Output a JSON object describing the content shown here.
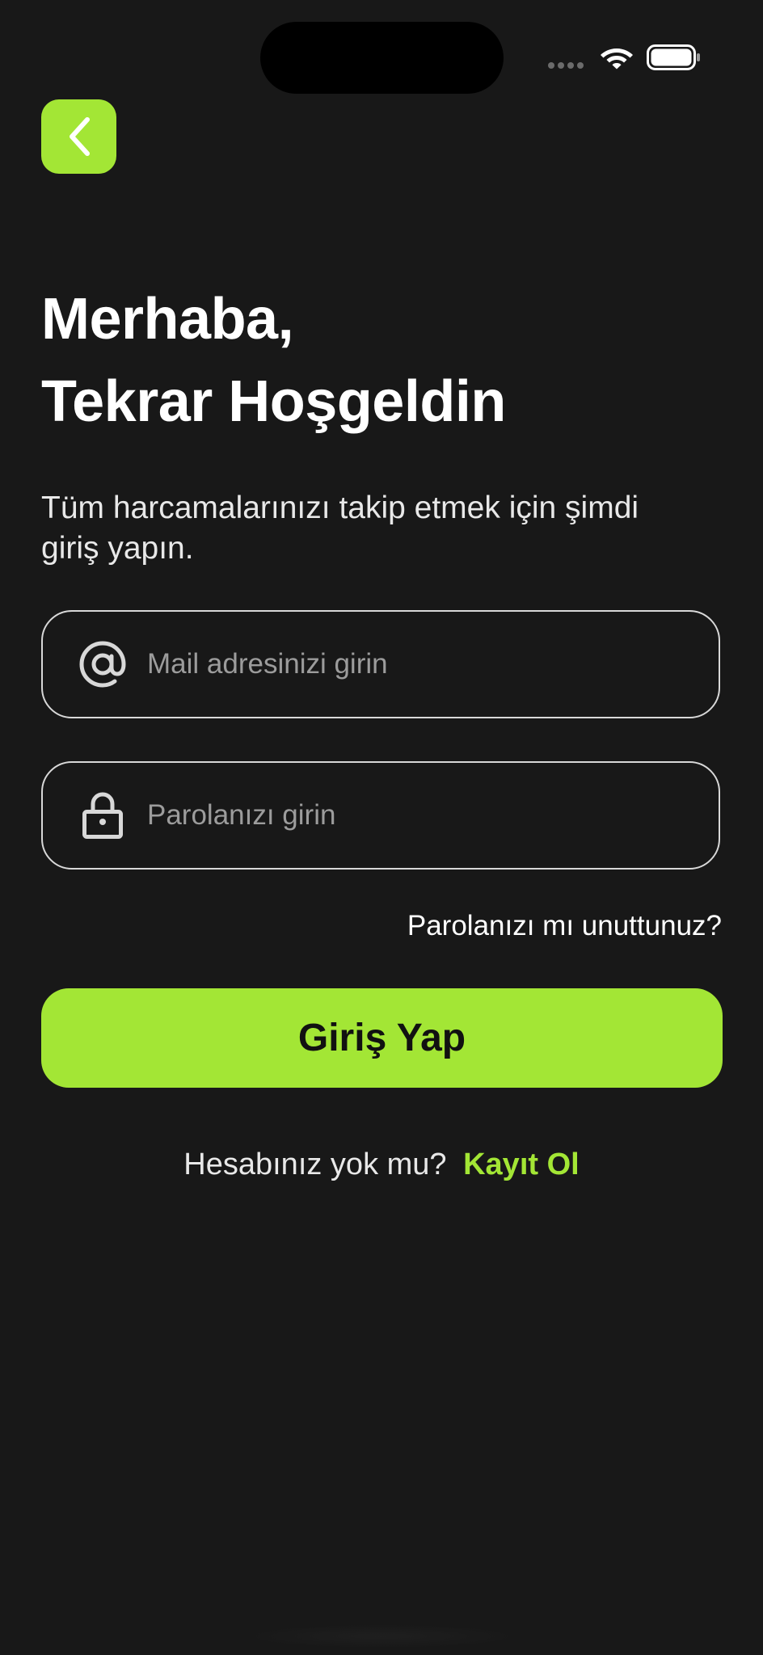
{
  "status_bar": {
    "icons": [
      "signal-dots-icon",
      "wifi-icon",
      "battery-icon"
    ]
  },
  "nav": {
    "back_icon": "chevron-left-icon"
  },
  "header": {
    "title_line1": "Merhaba,",
    "title_line2": "Tekrar Hoşgeldin",
    "subtitle": "Tüm harcamalarınızı takip etmek için şimdi giriş yapın."
  },
  "form": {
    "email": {
      "icon": "at-sign-icon",
      "placeholder": "Mail adresinizi girin",
      "value": ""
    },
    "password": {
      "icon": "lock-icon",
      "placeholder": "Parolanızı girin",
      "value": ""
    },
    "forgot_password": "Parolanızı mı unuttunuz?",
    "submit_label": "Giriş Yap"
  },
  "footer": {
    "prompt": "Hesabınız yok mu?",
    "signup_link": "Kayıt Ol"
  },
  "colors": {
    "background": "#181818",
    "accent": "#a3e635",
    "text": "#ffffff",
    "placeholder": "#9c9c9c",
    "border": "#d8d8d8"
  }
}
